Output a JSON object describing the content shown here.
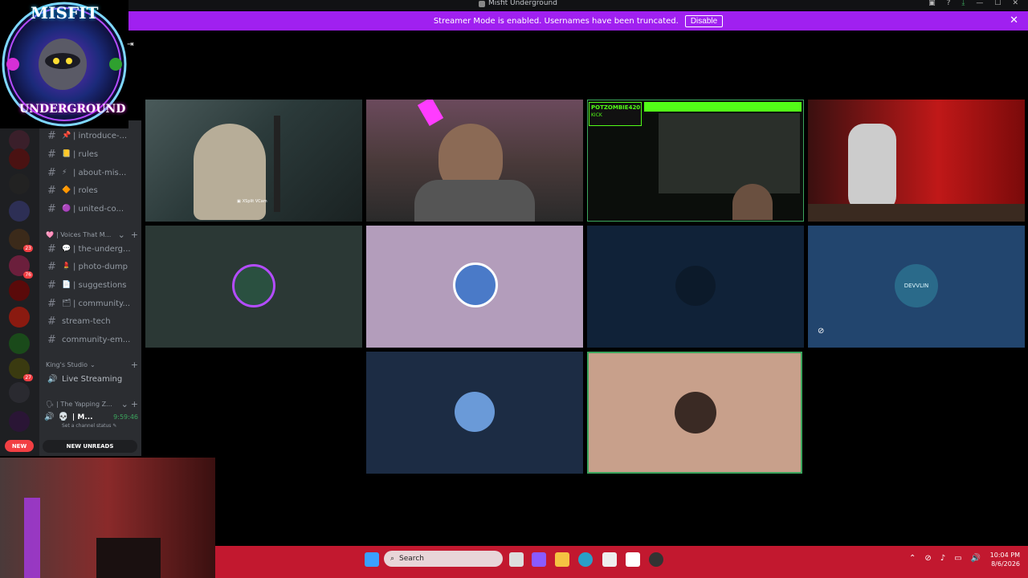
{
  "window": {
    "title": "Misfit Underground",
    "app_label": "Ai",
    "controls": [
      "▣",
      "?",
      "⤓",
      "—",
      "☐",
      "✕"
    ]
  },
  "banner": {
    "message": "Streamer Mode is enabled. Usernames have been truncated.",
    "disable_label": "Disable",
    "close": "✕"
  },
  "logo": {
    "text_top": "MISFIT",
    "text_bottom": "UNDERGROUND"
  },
  "servers": [
    {
      "color": "#3a1f2a"
    },
    {
      "color": "#4a1212",
      "badge": ""
    },
    {
      "color": "#222"
    },
    {
      "color": "#2d2f55"
    },
    {
      "color": "#3b2a1a",
      "badge": "23"
    },
    {
      "color": "#6b1f3c",
      "badge": "76"
    },
    {
      "color": "#5a0a0a"
    },
    {
      "color": "#8a1a10"
    },
    {
      "color": "#1a4a1a"
    },
    {
      "color": "#3a3a10",
      "badge": "27"
    },
    {
      "color": "#2a2a30"
    },
    {
      "color": "#2a1535"
    }
  ],
  "new_badge": "NEW",
  "channels": [
    {
      "hash": "#",
      "icon": "📌",
      "name": "| introduce-..."
    },
    {
      "hash": "#",
      "icon": "📒",
      "name": "| rules"
    },
    {
      "hash": "#",
      "icon": "⚡",
      "name": "| about-mis..."
    },
    {
      "hash": "#",
      "icon": "🔶",
      "name": "| roles"
    },
    {
      "hash": "#",
      "icon": "🟣",
      "name": "| united-co..."
    }
  ],
  "category_voices": {
    "icon": "🩷",
    "name": "| Voices That M...",
    "chevron": "⌄",
    "plus": "+"
  },
  "channels2": [
    {
      "hash": "#",
      "icon": "💬",
      "name": "| the-underg..."
    },
    {
      "hash": "#",
      "icon": "💄",
      "name": "| photo-dump"
    },
    {
      "hash": "#",
      "icon": "📄",
      "name": "| suggestions"
    },
    {
      "hash": "#",
      "icon": "🗂",
      "name": "| community..."
    },
    {
      "hash": "#",
      "icon": "",
      "name": "stream-tech"
    },
    {
      "hash": "#",
      "icon": "",
      "name": "community-em..."
    }
  ],
  "category_kings": {
    "name": "King's Studio",
    "chevron": "⌄",
    "plus": "+"
  },
  "live_streaming": {
    "icon": "🔊",
    "name": "Live Streaming"
  },
  "category_yapping": {
    "icon": "🗣",
    "name": "| The Yapping Z...",
    "chevron": "⌄",
    "plus": "+"
  },
  "user": {
    "name": "| M...",
    "timer": "9:59:46",
    "status": "Set a channel status ✎"
  },
  "new_unreads": "NEW UNREADS",
  "tiles": {
    "cam1_label": "XSplit VCam",
    "kick_title": "POTZOMBIE420",
    "kick_label": "KICK"
  },
  "avatar_texts": {
    "devvlin": "DEVVLIN"
  },
  "taskbar": {
    "search": "Search",
    "time": "10:04 PM",
    "date": "8/6/2026"
  },
  "colors": {
    "banner": "#a020f0",
    "taskbar": "#c2182f",
    "speaking": "#3ba55d",
    "tile_blue": "#22456e",
    "tile_pink": "#b39dbb",
    "tile_tan": "#c8a08b"
  }
}
